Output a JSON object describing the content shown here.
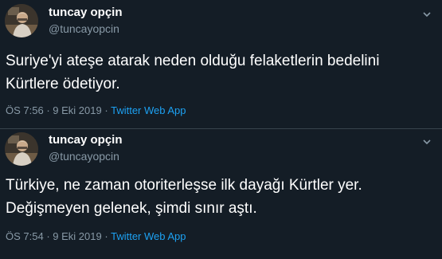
{
  "tweets": [
    {
      "author_name": "tuncay opçin",
      "author_handle": "@tuncayopcin",
      "text": "Suriye'yi ateşe atarak neden olduğu felaketlerin bedelini\nKürtlere ödetiyor.",
      "time": "ÖS 7:56",
      "date": "9 Eki 2019",
      "separator": "·",
      "source": "Twitter Web App",
      "avatar_icon": "profile-photo",
      "menu_icon": "chevron-down-icon"
    },
    {
      "author_name": "tuncay opçin",
      "author_handle": "@tuncayopcin",
      "text": "Türkiye, ne zaman otoriterleşse ilk dayağı Kürtler yer.\nDeğişmeyen gelenek, şimdi sınır aştı.",
      "time": "ÖS 7:54",
      "date": "9 Eki 2019",
      "separator": "·",
      "source": "Twitter Web App",
      "avatar_icon": "profile-photo",
      "menu_icon": "chevron-down-icon"
    }
  ],
  "colors": {
    "background": "#141d26",
    "text": "#ffffff",
    "secondary_text": "#8899a6",
    "link": "#1da1f2",
    "divider": "#38444d"
  }
}
